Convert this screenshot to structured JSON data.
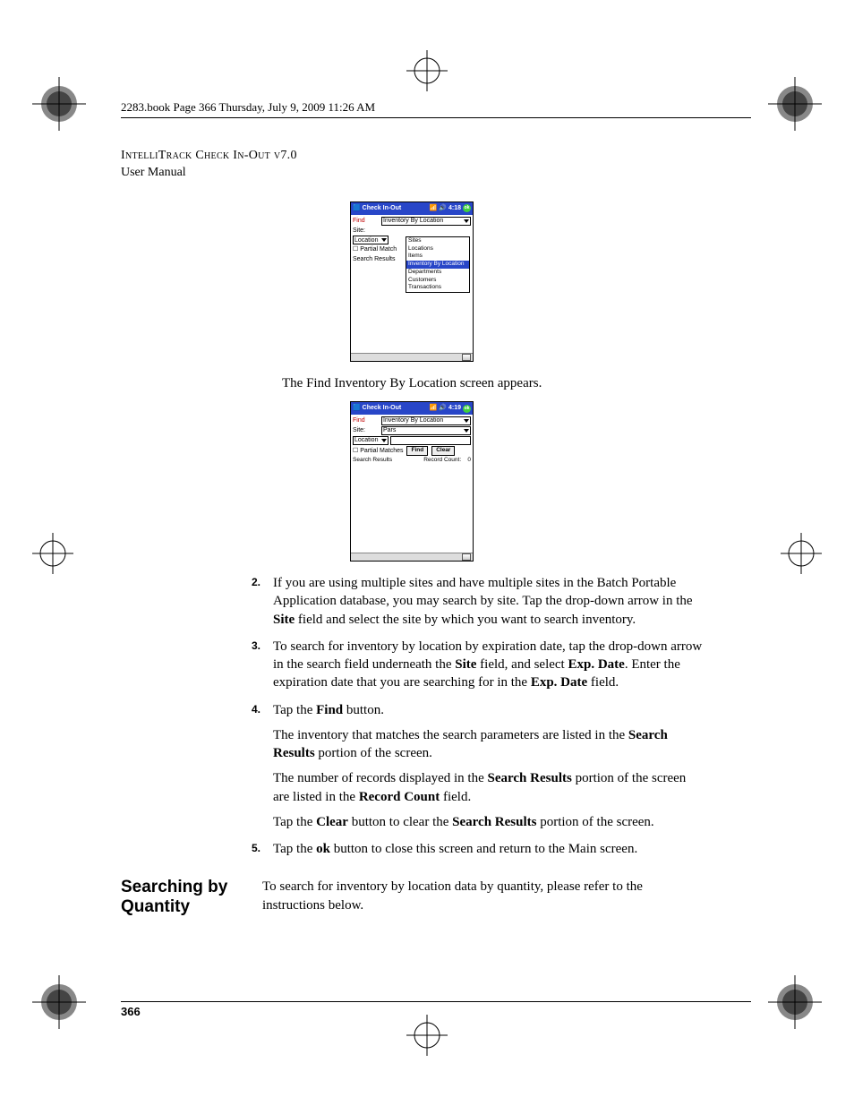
{
  "header": {
    "book_line": "2283.book  Page 366  Thursday, July 9, 2009  11:26 AM",
    "product": "IntelliTrack Check In-Out v7.0",
    "subtitle": "User Manual"
  },
  "screenshot1": {
    "title": "Check In-Out",
    "time": "4:18",
    "ok": "ok",
    "find_label": "Find",
    "find_value": "Inventory By Location",
    "site_label": "Site:",
    "row3_left": "Location",
    "partial": "Partial Match",
    "results": "Search Results",
    "dropdown": {
      "opt1": "Sites",
      "opt2": "Locations",
      "opt3": "Items",
      "opt4": "Inventory By Location",
      "opt5": "Departments",
      "opt6": "Customers",
      "opt7": "Transactions"
    }
  },
  "caption1": "The Find Inventory By Location screen appears.",
  "screenshot2": {
    "title": "Check In-Out",
    "time": "4:19",
    "ok": "ok",
    "find_label": "Find",
    "find_value": "Inventory By Location",
    "site_label": "Site:",
    "site_value": "Pars",
    "row3_left": "Location",
    "partial": "Partial Matches",
    "find_btn": "Find",
    "clear_btn": "Clear",
    "results": "Search Results",
    "record_count_label": "Record Count:",
    "record_count_value": "0"
  },
  "steps": {
    "n2": "2.",
    "s2": "If you are using multiple sites and have multiple sites in the Batch Portable Application database, you may search by site. Tap the drop-down arrow in the ",
    "s2b": "Site",
    "s2c": " field and select the site by which you want to search inventory.",
    "n3": "3.",
    "s3": "To search for inventory by location by expiration date, tap the drop-down arrow in the search field underneath the ",
    "s3b": "Site",
    "s3c": " field, and select ",
    "s3d": "Exp. Date",
    "s3e": ". Enter the expiration date that you are searching for in the ",
    "s3f": "Exp. Date",
    "s3g": " field.",
    "n4": "4.",
    "s4a": "Tap the ",
    "s4b": "Find",
    "s4c": " button.",
    "s4d": "The inventory that matches the search parameters are listed in the ",
    "s4e": "Search Results",
    "s4f": " portion of the screen.",
    "s4g": "The number of records displayed in the ",
    "s4h": "Search Results",
    "s4i": " portion of the screen are listed in the ",
    "s4j": "Record Count",
    "s4k": " field.",
    "s4l": "Tap the ",
    "s4m": "Clear",
    "s4n": " button to clear the ",
    "s4o": "Search Results",
    "s4p": " portion of the screen.",
    "n5": "5.",
    "s5a": "Tap the ",
    "s5b": "ok",
    "s5c": " button to close this screen and return to the Main screen."
  },
  "section": {
    "heading": "Searching by Quantity",
    "body": "To search for inventory by location data by quantity, please refer to the instructions below."
  },
  "page_number": "366"
}
